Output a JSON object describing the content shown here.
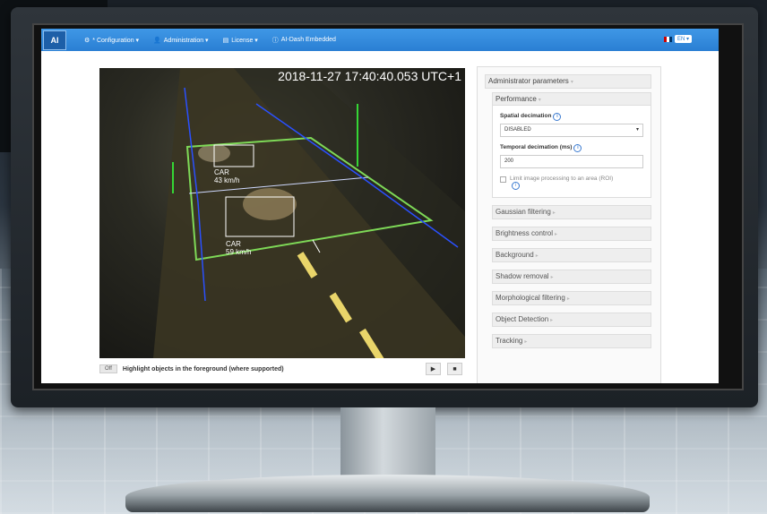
{
  "navbar": {
    "logo_text": "AI",
    "items": [
      {
        "icon": "gear-icon",
        "label": "* Configuration ▾"
      },
      {
        "icon": "user-icon",
        "label": "Administration ▾"
      },
      {
        "icon": "license-icon",
        "label": "License ▾"
      },
      {
        "icon": "info-circle-icon",
        "label": "AI-Dash Embedded"
      }
    ],
    "language": "EN ▾"
  },
  "video": {
    "timestamp": "2018-11-27 17:40:40.053 UTC+1",
    "detections": [
      {
        "label": "CAR",
        "speed": "43 km/h"
      },
      {
        "label": "CAR",
        "speed": "59 km/h"
      }
    ]
  },
  "controls": {
    "toggle_label": "Off",
    "highlight_label": "Highlight objects in the foreground (where supported)",
    "play": "▶",
    "stop": "■"
  },
  "panel": {
    "title": "Administrator parameters",
    "performance": {
      "title": "Performance",
      "spatial_label": "Spatial decimation",
      "spatial_value": "DISABLED",
      "temporal_label": "Temporal decimation (ms)",
      "temporal_value": "200",
      "roi_label": "Limit image processing to an area (ROI)"
    },
    "sections": [
      "Gaussian filtering",
      "Brightness control",
      "Background",
      "Shadow removal",
      "Morphological filtering",
      "Object Detection",
      "Tracking"
    ]
  }
}
